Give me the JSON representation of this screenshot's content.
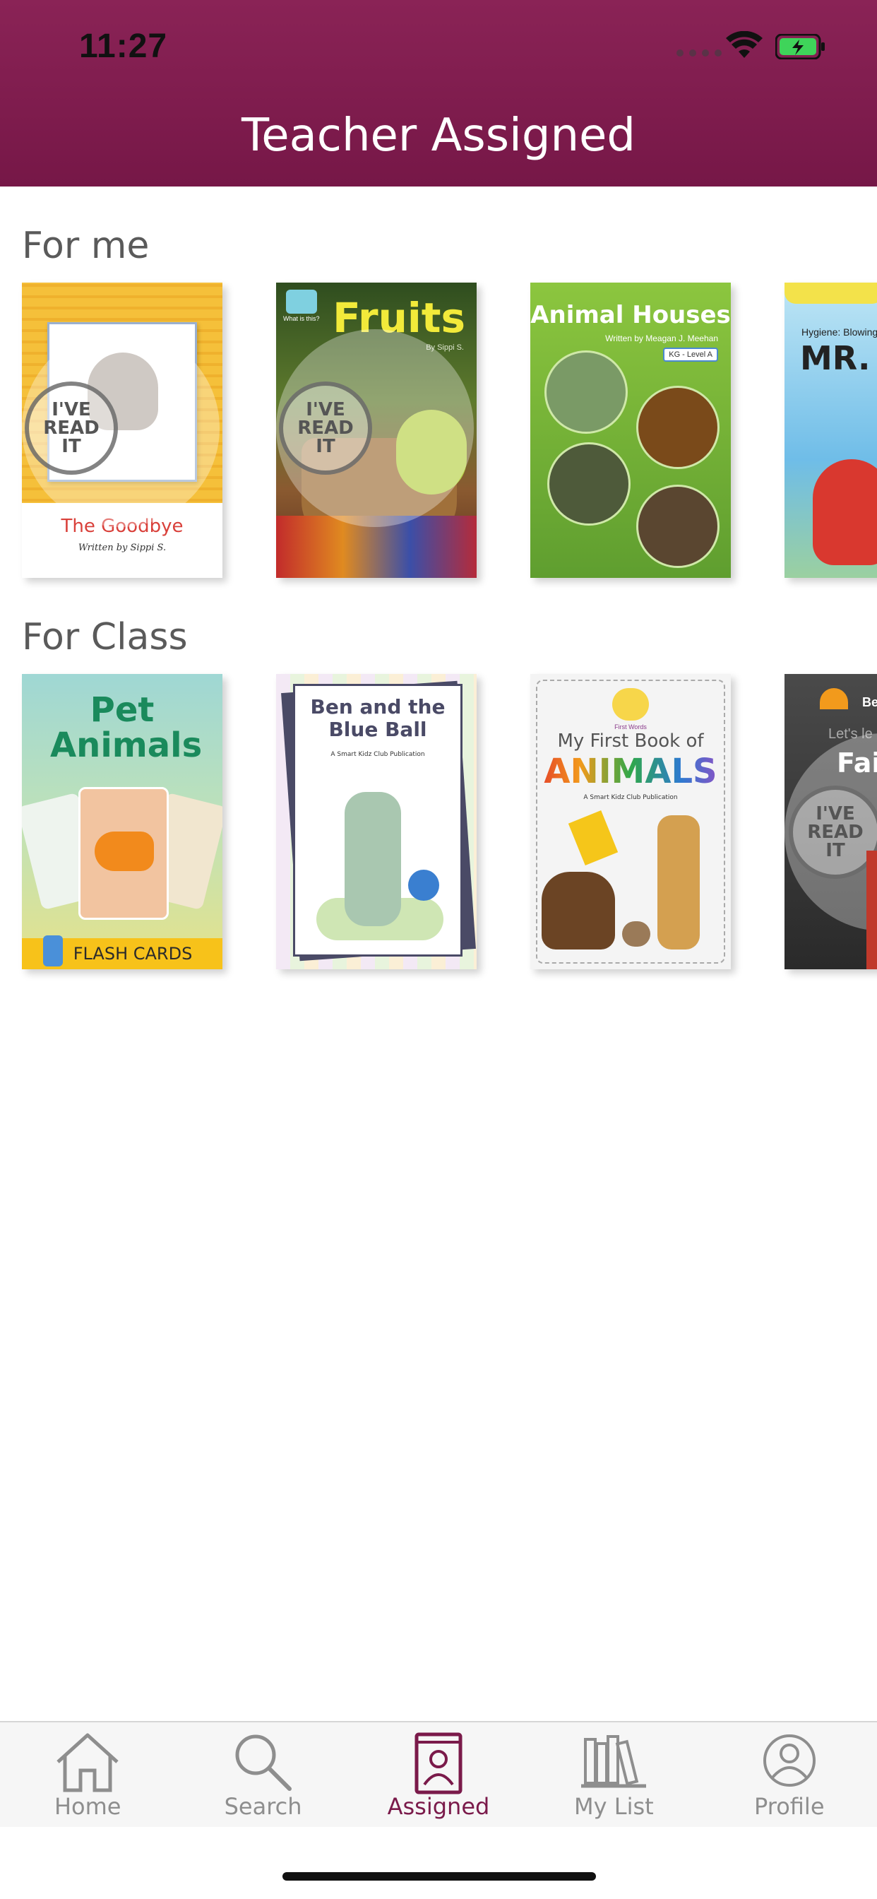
{
  "status_bar": {
    "time": "11:27"
  },
  "header": {
    "title": "Teacher Assigned"
  },
  "sections": [
    {
      "title": "For me",
      "books": [
        {
          "title": "The Goodbye",
          "author": "Written by Sippi S.",
          "stamp": "I'VE READ IT"
        },
        {
          "title": "Fruits",
          "author": "By Sippi S.",
          "badge": "What is this?",
          "stamp": "I'VE READ IT"
        },
        {
          "title": "Animal Houses",
          "author": "Written by Meagan J. Meehan",
          "level": "KG - Level A"
        },
        {
          "title": "MR. S",
          "subtitle": "Hygiene: Blowing"
        }
      ]
    },
    {
      "title": "For Class",
      "books": [
        {
          "title": "Pet Animals",
          "footer": "FLASH CARDS"
        },
        {
          "title": "Ben and the Blue Ball",
          "publisher": "A Smart Kidz Club Publication"
        },
        {
          "title": "My First Book of",
          "title_big": "ANIMALS",
          "publisher": "A Smart Kidz Club Publication",
          "badge": "First Words"
        },
        {
          "title": "Fair",
          "subtitle": "Let's le",
          "brand": "Be",
          "stamp": "I'VE READ IT"
        }
      ]
    }
  ],
  "tabs": [
    {
      "label": "Home",
      "icon": "home-icon",
      "active": false
    },
    {
      "label": "Search",
      "icon": "search-icon",
      "active": false
    },
    {
      "label": "Assigned",
      "icon": "assigned-book-icon",
      "active": true
    },
    {
      "label": "My List",
      "icon": "bookshelf-icon",
      "active": false
    },
    {
      "label": "Profile",
      "icon": "profile-icon",
      "active": false
    }
  ],
  "colors": {
    "header": "#7e1b4d",
    "active_tab": "#7a1a4a",
    "inactive_tab": "#8e8e8e"
  }
}
